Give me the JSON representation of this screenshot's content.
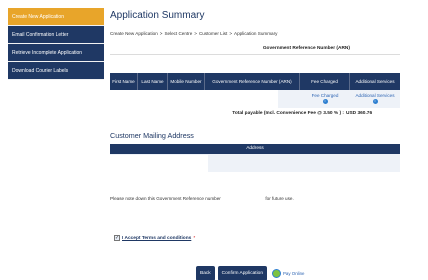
{
  "sidebar": {
    "items": [
      {
        "label": "Create New Application",
        "active": true
      },
      {
        "label": "Email Confirmation Letter",
        "active": false
      },
      {
        "label": "Retrieve Incomplete Application",
        "active": false
      },
      {
        "label": "Download Courier Labels",
        "active": false
      }
    ]
  },
  "page": {
    "title": "Application Summary",
    "breadcrumb": [
      "Create New Application",
      "Select Centre",
      "Customer List",
      "Application Summary"
    ],
    "breadcrumb_sep": ">"
  },
  "summary_table": {
    "arn_label": "Government Reference Number (ARN)",
    "columns": [
      "First Name",
      "Last Name",
      "Mobile Number",
      "Government Reference Number (ARN)",
      "Fee Charged",
      "Additional Services"
    ],
    "row": {
      "fee_link": "Fee Charged",
      "services_link": "Additional Services"
    },
    "total_label": "Total payable (Incl. Convenience Fee @ 3.50 % ) :",
    "total_value": "USD 360.76"
  },
  "mailing": {
    "title": "Customer Mailing Address",
    "column": "Address"
  },
  "note": {
    "before": "Please note down this Government Reference number",
    "after": "for future use."
  },
  "terms": {
    "label": "I Accept Terms and conditions",
    "required": "*",
    "checked": true
  },
  "buttons": {
    "back": "Back",
    "confirm": "Confirm Application",
    "pay": "Pay Online"
  },
  "colors": {
    "navy": "#1f3864",
    "accent": "#e8a52a",
    "link": "#2d64b3"
  }
}
